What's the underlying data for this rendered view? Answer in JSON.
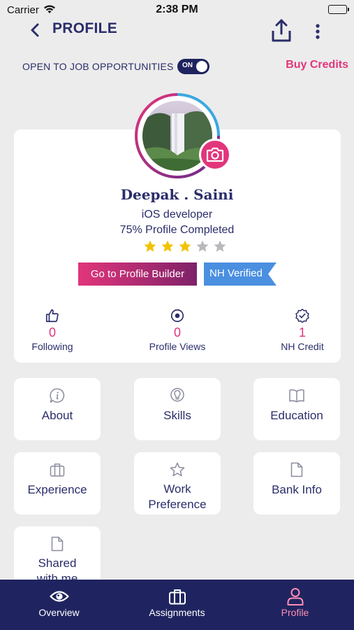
{
  "status_bar": {
    "carrier": "Carrier",
    "time": "2:38 PM"
  },
  "header": {
    "title": "PROFILE"
  },
  "job": {
    "label": "OPEN TO JOB OPPORTUNITIES",
    "toggle_state": "ON",
    "buy_credits": "Buy Credits"
  },
  "profile": {
    "name": "Deepak . Saini",
    "role": "iOS developer",
    "completion_text": "75% Profile Completed",
    "rating": 3,
    "rating_max": 5,
    "builder_button": "Go to Profile Builder",
    "verified_badge": "NH Verified"
  },
  "stats": [
    {
      "value": "0",
      "label": "Following",
      "icon": "thumbs-up-icon"
    },
    {
      "value": "0",
      "label": "Profile Views",
      "icon": "eye-circle-icon"
    },
    {
      "value": "1",
      "label": "NH Credit",
      "icon": "verified-check-icon"
    }
  ],
  "tiles": [
    {
      "label": "About",
      "icon": "info-bubble-icon"
    },
    {
      "label": "Skills",
      "icon": "lightbulb-icon"
    },
    {
      "label": "Education",
      "icon": "book-icon"
    },
    {
      "label": "Experience",
      "icon": "briefcase-icon"
    },
    {
      "label": "Work Preference",
      "icon": "star-outline-icon"
    },
    {
      "label": "Bank Info",
      "icon": "document-icon"
    },
    {
      "label": "Shared with me",
      "icon": "document-icon"
    }
  ],
  "tabs": [
    {
      "label": "Overview",
      "icon": "eye-icon"
    },
    {
      "label": "Assignments",
      "icon": "briefcase-icon"
    },
    {
      "label": "Profile",
      "icon": "person-icon",
      "active": true
    }
  ],
  "colors": {
    "navy": "#1f2460",
    "text": "#2a2d6a",
    "accent_pink": "#e2357b",
    "verified_blue": "#4a8fe0",
    "star_gold": "#f2c200"
  }
}
